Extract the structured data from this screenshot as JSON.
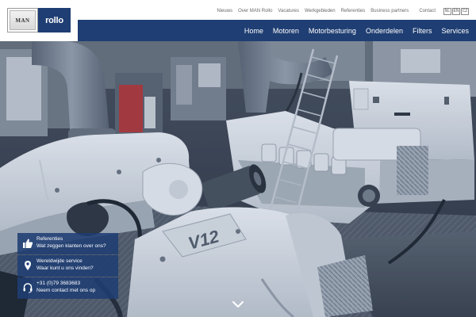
{
  "logo": {
    "man_text": "MAN",
    "rollo_text": "rollo"
  },
  "topnav": {
    "items": [
      "Nieuws",
      "Over MAN Rollo",
      "Vacatures",
      "Werkgebieden",
      "Referenties",
      "Business partners",
      "Contact"
    ],
    "languages": [
      "NL",
      "EN",
      "CZ"
    ]
  },
  "mainnav": {
    "items": [
      "Home",
      "Motoren",
      "Motorbesturing",
      "Onderdelen",
      "Filters",
      "Services"
    ]
  },
  "hero": {
    "engine_badge": "V12"
  },
  "info_boxes": [
    {
      "icon": "thumbs-up-icon",
      "line1": "Referenties",
      "line2": "Wat zeggen klanten over ons?"
    },
    {
      "icon": "map-pin-icon",
      "line1": "Wereldwijde service",
      "line2": "Waar kunt u ons vinden?"
    },
    {
      "icon": "headset-icon",
      "line1": "+31 (0)79 3683683",
      "line2": "Neem contact met ons op"
    }
  ],
  "scroll_icon": "chevron-down-icon",
  "colors": {
    "brand_blue": "#1f3e73",
    "topnav_text": "#6a6a6a"
  }
}
